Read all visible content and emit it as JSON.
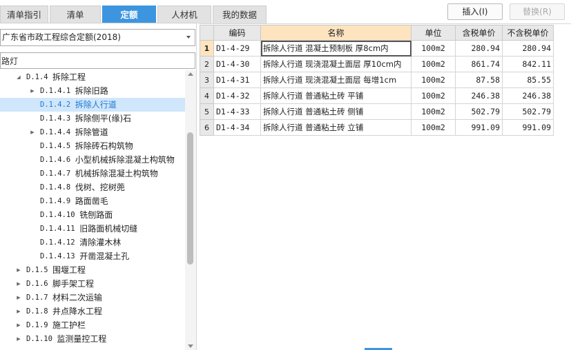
{
  "tabs": [
    {
      "label": "清单指引",
      "active": false
    },
    {
      "label": "清单",
      "active": false
    },
    {
      "label": "定额",
      "active": true
    },
    {
      "label": "人材机",
      "active": false
    },
    {
      "label": "我的数据",
      "active": false
    }
  ],
  "actions": {
    "insert_label": "插入(I)",
    "replace_label": "替换(R)"
  },
  "left": {
    "quota_library": "广东省市政工程综合定额(2018)",
    "search_value": "路灯"
  },
  "tree": [
    {
      "toggle": "expanded",
      "code": "D.1.4",
      "label": "拆除工程",
      "level": 0,
      "selected": false
    },
    {
      "toggle": "collapsed",
      "code": "D.1.4.1",
      "label": "拆除旧路",
      "level": 1,
      "selected": false
    },
    {
      "toggle": "none",
      "code": "D.1.4.2",
      "label": "拆除人行道",
      "level": 1,
      "selected": true
    },
    {
      "toggle": "none",
      "code": "D.1.4.3",
      "label": "拆除侧平(缘)石",
      "level": 1,
      "selected": false
    },
    {
      "toggle": "collapsed",
      "code": "D.1.4.4",
      "label": "拆除管道",
      "level": 1,
      "selected": false
    },
    {
      "toggle": "none",
      "code": "D.1.4.5",
      "label": "拆除砖石构筑物",
      "level": 1,
      "selected": false
    },
    {
      "toggle": "none",
      "code": "D.1.4.6",
      "label": "小型机械拆除混凝土构筑物",
      "level": 1,
      "selected": false
    },
    {
      "toggle": "none",
      "code": "D.1.4.7",
      "label": "机械拆除混凝土构筑物",
      "level": 1,
      "selected": false
    },
    {
      "toggle": "none",
      "code": "D.1.4.8",
      "label": "伐树、挖树蔸",
      "level": 1,
      "selected": false
    },
    {
      "toggle": "none",
      "code": "D.1.4.9",
      "label": "路面凿毛",
      "level": 1,
      "selected": false
    },
    {
      "toggle": "none",
      "code": "D.1.4.10",
      "label": "铣刨路面",
      "level": 1,
      "selected": false
    },
    {
      "toggle": "none",
      "code": "D.1.4.11",
      "label": "旧路面机械切缝",
      "level": 1,
      "selected": false
    },
    {
      "toggle": "none",
      "code": "D.1.4.12",
      "label": "清除灌木林",
      "level": 1,
      "selected": false
    },
    {
      "toggle": "none",
      "code": "D.1.4.13",
      "label": "开凿混凝土孔",
      "level": 1,
      "selected": false
    },
    {
      "toggle": "collapsed",
      "code": "D.1.5",
      "label": "围堰工程",
      "level": 0,
      "selected": false
    },
    {
      "toggle": "collapsed",
      "code": "D.1.6",
      "label": "脚手架工程",
      "level": 0,
      "selected": false
    },
    {
      "toggle": "collapsed",
      "code": "D.1.7",
      "label": "材料二次运输",
      "level": 0,
      "selected": false
    },
    {
      "toggle": "collapsed",
      "code": "D.1.8",
      "label": "井点降水工程",
      "level": 0,
      "selected": false
    },
    {
      "toggle": "collapsed",
      "code": "D.1.9",
      "label": "施工护栏",
      "level": 0,
      "selected": false
    },
    {
      "toggle": "collapsed",
      "code": "D.1.10",
      "label": "监测量控工程",
      "level": 0,
      "selected": false
    }
  ],
  "grid": {
    "columns": [
      "",
      "编码",
      "名称",
      "单位",
      "含税单价",
      "不含税单价"
    ],
    "rows": [
      {
        "num": "1",
        "code": "D1-4-29",
        "name": "拆除人行道 混凝土预制板 厚8cm内",
        "unit": "100m2",
        "price_tax": "280.94",
        "price_notax": "280.94"
      },
      {
        "num": "2",
        "code": "D1-4-30",
        "name": "拆除人行道 现浇混凝土面层 厚10cm内",
        "unit": "100m2",
        "price_tax": "861.74",
        "price_notax": "842.11"
      },
      {
        "num": "3",
        "code": "D1-4-31",
        "name": "拆除人行道 现浇混凝土面层 每增1cm",
        "unit": "100m2",
        "price_tax": "87.58",
        "price_notax": "85.55"
      },
      {
        "num": "4",
        "code": "D1-4-32",
        "name": "拆除人行道 普通粘土砖 平铺",
        "unit": "100m2",
        "price_tax": "246.38",
        "price_notax": "246.38"
      },
      {
        "num": "5",
        "code": "D1-4-33",
        "name": "拆除人行道 普通粘土砖 侧铺",
        "unit": "100m2",
        "price_tax": "502.79",
        "price_notax": "502.79"
      },
      {
        "num": "6",
        "code": "D1-4-34",
        "name": "拆除人行道 普通粘土砖 立铺",
        "unit": "100m2",
        "price_tax": "991.09",
        "price_notax": "991.09"
      }
    ]
  }
}
